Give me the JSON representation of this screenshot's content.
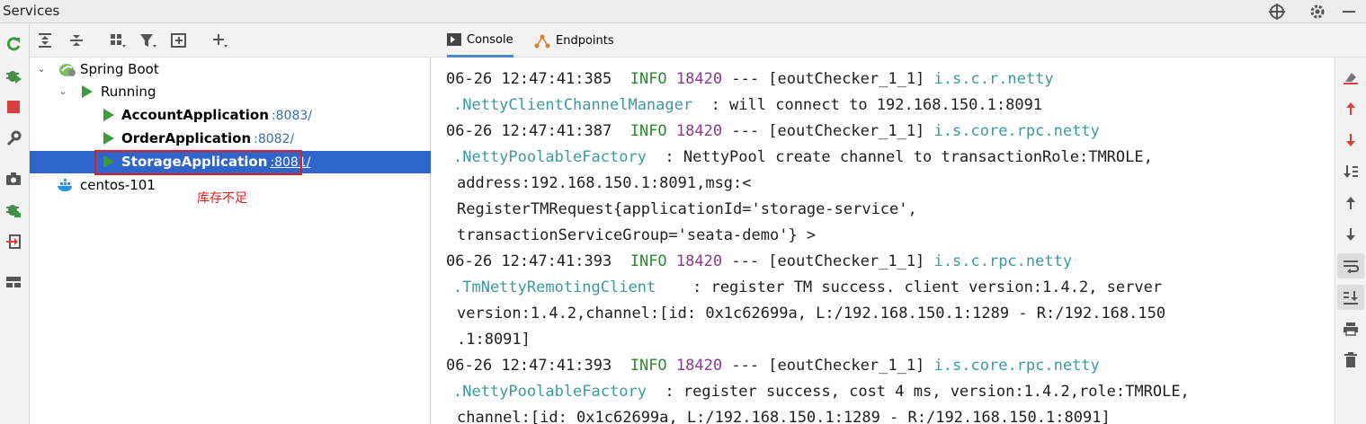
{
  "window": {
    "title": "Services",
    "icons": [
      "target-icon",
      "gear-icon",
      "minimize-icon"
    ]
  },
  "left_toolbar": {
    "icons": [
      "rerun-icon",
      "debug-icon",
      "stop-icon",
      "wrench-icon",
      "camera-icon",
      "debug-attach-icon",
      "exit-icon",
      "layout-icon"
    ],
    "colors": {
      "rerun": "#3c9a3c",
      "stop": "#d64040"
    }
  },
  "tree_toolbar": {
    "icons": [
      "expand-all-icon",
      "collapse-all-icon",
      "group-icon",
      "filter-icon",
      "new-group-icon",
      "add-icon"
    ]
  },
  "tree": {
    "root": {
      "label": "Spring Boot"
    },
    "group": {
      "label": "Running"
    },
    "apps": [
      {
        "name": "AccountApplication",
        "port": ":8083/"
      },
      {
        "name": "OrderApplication",
        "port": ":8082/"
      },
      {
        "name": "StorageApplication",
        "port": ":8081/",
        "selected": true
      }
    ],
    "docker": {
      "label": "centos-101"
    },
    "note": "库存不足",
    "selection_color": "#2f65ca",
    "highlight_color": "#e02020"
  },
  "console": {
    "tabs": [
      {
        "label": "Console",
        "active": true
      },
      {
        "label": "Endpoints",
        "active": false
      }
    ],
    "logs": [
      {
        "time": "06-26 12:47:41:385",
        "level": "INFO",
        "pid": "18420",
        "thread": "--- [eoutChecker_1_1]",
        "logger": "i.s.c.r.netty",
        "cont": [
          {
            "logger": ".NettyClientChannelManager",
            "text": "  : will connect to 192.168.150.1:8091"
          }
        ]
      },
      {
        "time": "06-26 12:47:41:387",
        "level": "INFO",
        "pid": "18420",
        "thread": "--- [eoutChecker_1_1]",
        "logger": "i.s.core.rpc.netty",
        "cont": [
          {
            "logger": ".NettyPoolableFactory",
            "text": "  : NettyPool create channel to transactionRole:TMROLE,"
          },
          {
            "logger": "",
            "text": "address:192.168.150.1:8091,msg:<"
          },
          {
            "logger": "",
            "text": "RegisterTMRequest{applicationId='storage-service',"
          },
          {
            "logger": "",
            "text": "transactionServiceGroup='seata-demo'} >"
          }
        ]
      },
      {
        "time": "06-26 12:47:41:393",
        "level": "INFO",
        "pid": "18420",
        "thread": "--- [eoutChecker_1_1]",
        "logger": "i.s.c.rpc.netty",
        "cont": [
          {
            "logger": ".TmNettyRemotingClient",
            "text": "    : register TM success. client version:1.4.2, server"
          },
          {
            "logger": "",
            "text": "version:1.4.2,channel:[id: 0x1c62699a, L:/192.168.150.1:1289 - R:/192.168.150"
          },
          {
            "logger": "",
            "text": ".1:8091]"
          }
        ]
      },
      {
        "time": "06-26 12:47:41:393",
        "level": "INFO",
        "pid": "18420",
        "thread": "--- [eoutChecker_1_1]",
        "logger": "i.s.core.rpc.netty",
        "cont": [
          {
            "logger": ".NettyPoolableFactory",
            "text": "  : register success, cost 4 ms, version:1.4.2,role:TMROLE,"
          },
          {
            "logger": "",
            "text": "channel:[id: 0x1c62699a, L:/192.168.150.1:1289 - R:/192.168.150.1:8091]"
          }
        ]
      }
    ],
    "colors": {
      "info": "#2a8a2a",
      "pid": "#8a3a8a",
      "logger": "#3a9aa0"
    }
  },
  "right_toolbar": {
    "icons": [
      "clear-icon",
      "up-red-icon",
      "down-red-icon",
      "sort-icon",
      "arrow-up-icon",
      "arrow-down-icon",
      "soft-wrap-icon",
      "scroll-to-end-icon",
      "print-icon",
      "trash-icon"
    ]
  }
}
